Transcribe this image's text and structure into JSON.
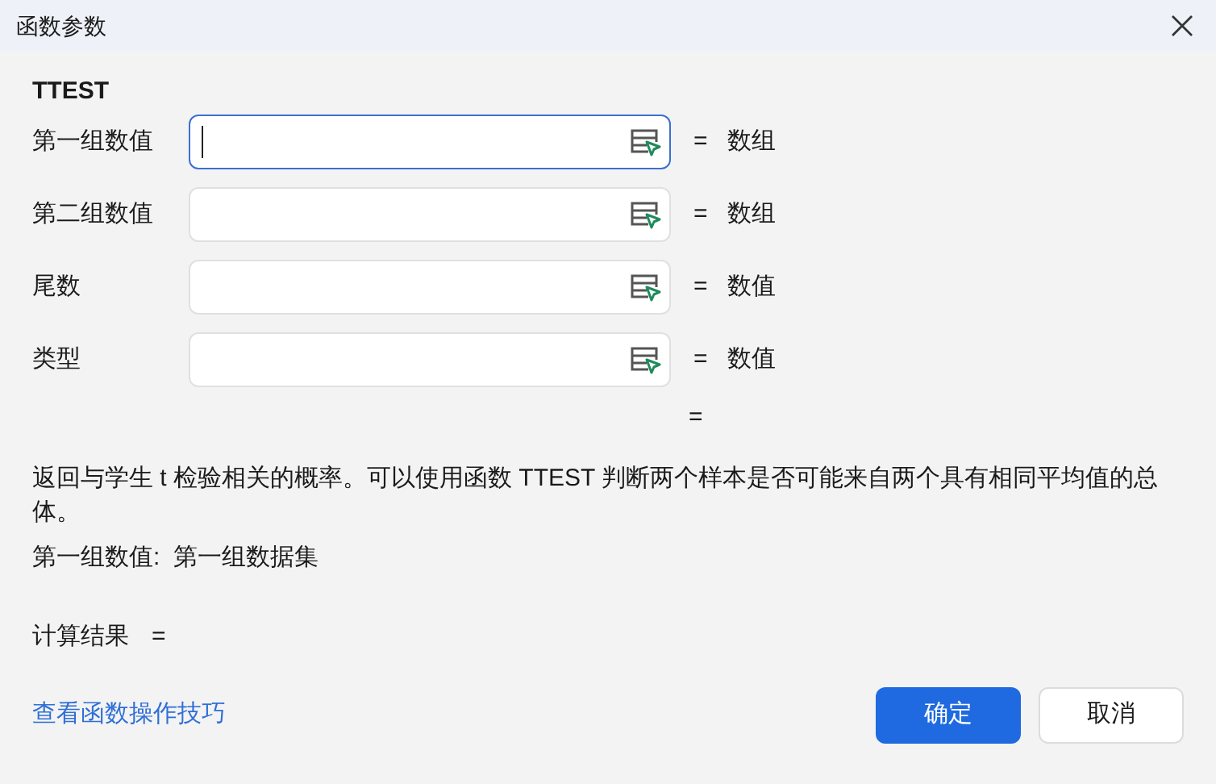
{
  "window": {
    "title": "函数参数"
  },
  "function_name": "TTEST",
  "arguments": [
    {
      "label": "第一组数值",
      "focused": true,
      "equals": "=",
      "result": "数组"
    },
    {
      "label": "第二组数值",
      "focused": false,
      "equals": "=",
      "result": "数组"
    },
    {
      "label": "尾数",
      "focused": false,
      "equals": "=",
      "result": "数值"
    },
    {
      "label": "类型",
      "focused": false,
      "equals": "=",
      "result": "数值"
    }
  ],
  "function_equals": "=",
  "description": "返回与学生 t 检验相关的概率。可以使用函数 TTEST 判断两个样本是否可能来自两个具有相同平均值的总体。",
  "argument_help": "第一组数值:  第一组数据集",
  "calculation_result": {
    "label": "计算结果",
    "equals": "="
  },
  "help_link": "查看函数操作技巧",
  "buttons": [
    {
      "label": "确定",
      "kind": "primary"
    },
    {
      "label": "取消",
      "kind": "secondary"
    }
  ]
}
